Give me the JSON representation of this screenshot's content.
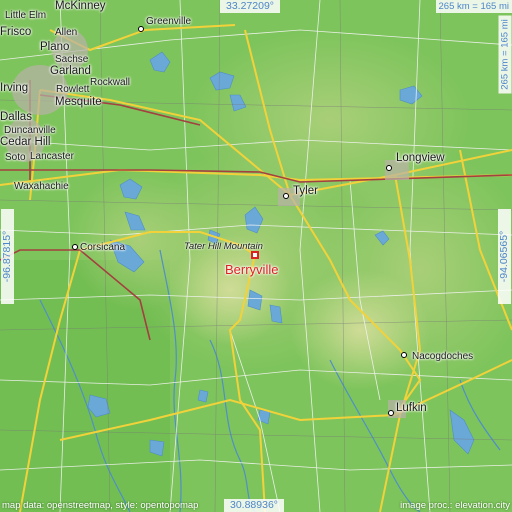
{
  "map": {
    "target": "Berryville",
    "peak": "Tater Hill Mountain",
    "coords": {
      "top": "33.27209°",
      "bottom": "30.88936°",
      "left": "-96.87815°",
      "right": "-94.06565°"
    },
    "scale_h": "265 km = 165 mi",
    "scale_v": "265 km = 165 mi",
    "credit_left": "map data: openstreetmap, style: opentopomap",
    "credit_right": "image proc.: elevation.city",
    "cities": [
      "Little Elm",
      "McKinney",
      "Greenville",
      "Frisco",
      "Allen",
      "Plano",
      "Sachse",
      "Garland",
      "Rockwall",
      "Irving",
      "Rowlett",
      "Mesquite",
      "Dallas",
      "Duncanville",
      "Cedar Hill",
      "Soto",
      "Lancaster",
      "Longview",
      "Tyler",
      "Waxahachie",
      "Corsicana",
      "Nacogdoches",
      "Lufkin"
    ],
    "colors": {
      "land_low": "#7cc35a",
      "land_high": "#c8d890",
      "water": "#6aa8d8",
      "target": "#dd2222",
      "coord_text": "#4d86c8"
    }
  }
}
